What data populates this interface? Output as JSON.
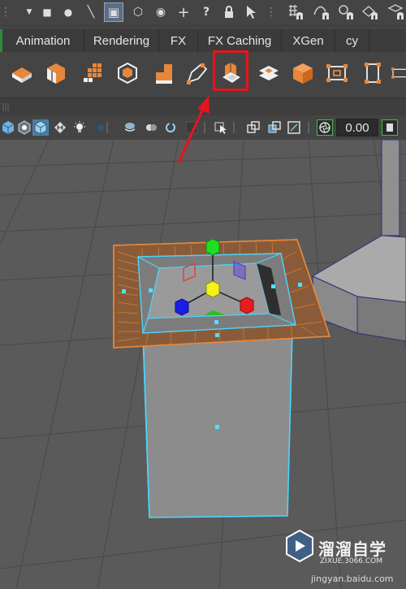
{
  "top_toolbar": {
    "tools": [
      {
        "name": "menu-arrow-icon",
        "glyph": "▼"
      },
      {
        "name": "select-object-icon",
        "glyph": "■"
      },
      {
        "name": "select-component-icon",
        "glyph": "●"
      },
      {
        "name": "line-icon",
        "glyph": "╲"
      },
      {
        "name": "hierarchy-icon",
        "glyph": "▣"
      },
      {
        "name": "lasso-icon",
        "glyph": "⬡"
      },
      {
        "name": "target-icon",
        "glyph": "◉"
      },
      {
        "name": "plus-icon",
        "glyph": "+"
      },
      {
        "name": "help-icon",
        "glyph": "?"
      },
      {
        "name": "lock-icon",
        "glyph": "🔒"
      },
      {
        "name": "cursor-icon",
        "glyph": "⌖"
      }
    ],
    "snap_icons": [
      "snap-grid-icon",
      "snap-curve-icon",
      "snap-point-icon",
      "snap-plane-icon"
    ]
  },
  "shelf_tabs": [
    "Animation",
    "Rendering",
    "FX",
    "FX Caching",
    "XGen",
    "cy"
  ],
  "shelf_icons": [
    "plane-orange-icon",
    "cube-split-icon",
    "grid-orange-icon",
    "cube-outline-icon",
    "blocks-icon",
    "pen-tool-icon",
    "extrude-icon",
    "layers-icon",
    "cube-orange-icon",
    "bounding-box-icon",
    "column-box-icon",
    "half-box-icon"
  ],
  "panel_icons": [
    "cube-shade-icon",
    "cube-wire-icon",
    "cube-smooth-icon",
    "checker-icon",
    "light-icon",
    "dot-icon",
    "plate-icon",
    "double-circle-icon",
    "ring-icon",
    "square-dark-icon",
    "divider-icon",
    "camera-cursor-icon",
    "divider-icon",
    "overlay-icon",
    "overlay-blue-icon",
    "frame-icon",
    "divider-icon",
    "aperture-icon",
    "frame-bracket-icon"
  ],
  "panel": {
    "exposure_value": "0.00"
  },
  "colors": {
    "highlight": "#e6141e",
    "selection_wire": "#49d6ff",
    "orange_wire": "#e8873a",
    "arrow": "#e6141e"
  },
  "watermark": {
    "title": "溜溜自学",
    "subtitle": "ZIXUE.3066.COM",
    "url": "jingyan.baidu.com"
  }
}
